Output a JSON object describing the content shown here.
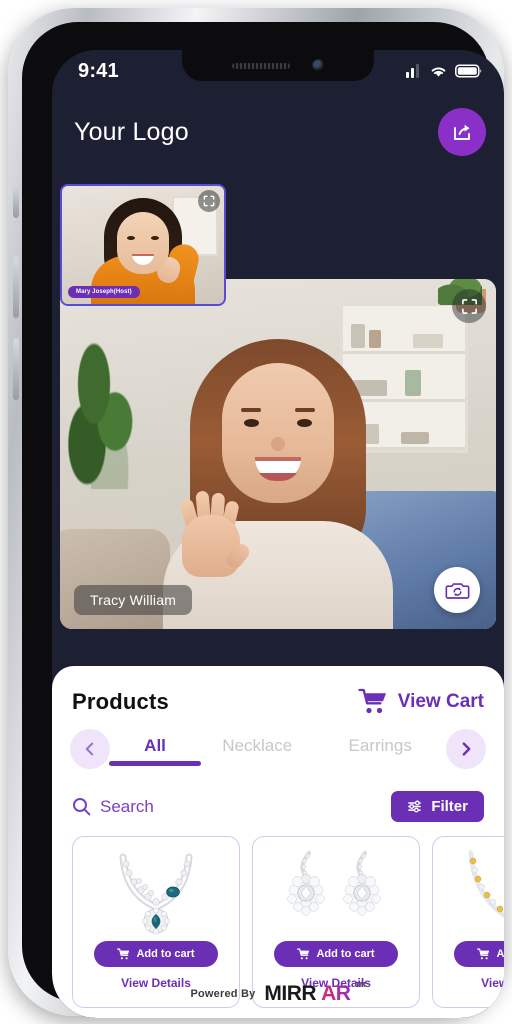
{
  "status_bar": {
    "time": "9:41",
    "icons": [
      "signal-icon",
      "wifi-icon",
      "battery-icon"
    ]
  },
  "header": {
    "logo_text": "Your Logo",
    "share_icon": "share-icon"
  },
  "video": {
    "main": {
      "participant_name": "Tracy William",
      "camera_flip_icon": "camera-flip-icon",
      "focus_icon": "focus-frame-icon"
    },
    "pip": {
      "participant_name": "Mary Joseph(Host)",
      "focus_icon": "focus-frame-icon"
    }
  },
  "products": {
    "title": "Products",
    "view_cart_label": "View Cart",
    "cart_icon": "shopping-cart-icon",
    "prev_icon": "chevron-left-icon",
    "next_icon": "chevron-right-icon",
    "tabs": [
      {
        "label": "All",
        "active": true
      },
      {
        "label": "Necklace",
        "active": false
      },
      {
        "label": "Earrings",
        "active": false
      }
    ],
    "search": {
      "label": "Search",
      "icon": "search-icon"
    },
    "filter": {
      "label": "Filter",
      "icon": "filter-sliders-icon"
    },
    "cards": [
      {
        "image": "diamond-necklace-with-teal-stones",
        "add_label": "Add to cart",
        "details_label": "View Details",
        "cart_icon": "cart-icon"
      },
      {
        "image": "diamond-floral-drop-earrings",
        "add_label": "Add to cart",
        "details_label": "View Details",
        "cart_icon": "cart-icon"
      },
      {
        "image": "gold-beaded-necklace",
        "add_label": "Add to cart",
        "details_label": "View Details",
        "cart_icon": "cart-icon"
      }
    ]
  },
  "footer": {
    "powered_by": "Powered By",
    "brand_first": "MIRR",
    "brand_second": "AR",
    "trademark": "TM"
  },
  "colors": {
    "accent_purple": "#6b2fb5",
    "share_purple": "#8b2fc9",
    "screen_dark": "#1d2032",
    "tab_inactive": "#c7c7cc",
    "card_border": "#d9c6ef"
  }
}
